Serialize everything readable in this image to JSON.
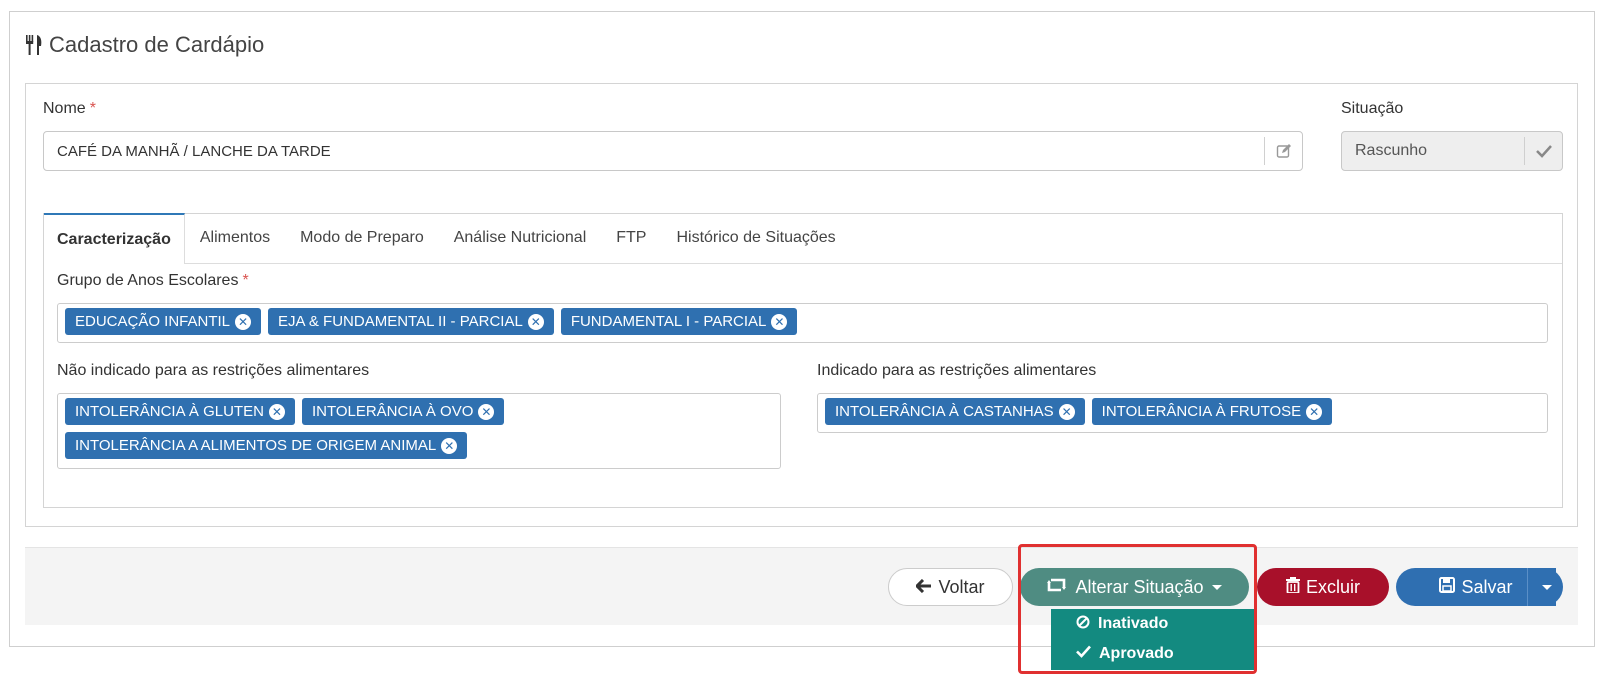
{
  "page": {
    "title": "Cadastro de Cardápio",
    "title_icon": "utensils-icon"
  },
  "form": {
    "nome_label": "Nome",
    "required_mark": "*",
    "nome_value": "CAFÉ DA MANHÃ / LANCHE DA TARDE",
    "situacao_label": "Situação",
    "situacao_value": "Rascunho"
  },
  "tabs": [
    {
      "label": "Caracterização",
      "active": true
    },
    {
      "label": "Alimentos"
    },
    {
      "label": "Modo de Preparo"
    },
    {
      "label": "Análise Nutricional"
    },
    {
      "label": "FTP"
    },
    {
      "label": "Histórico de Situações"
    }
  ],
  "caracterizacao": {
    "grupo_label": "Grupo de Anos Escolares",
    "grupo_tags": [
      "EDUCAÇÃO INFANTIL",
      "EJA & FUNDAMENTAL II - PARCIAL",
      "FUNDAMENTAL I - PARCIAL"
    ],
    "nao_indicado_label": "Não indicado para as restrições alimentares",
    "nao_indicado_tags": [
      "INTOLERÂNCIA À GLUTEN",
      "INTOLERÂNCIA À OVO",
      "INTOLERÂNCIA A ALIMENTOS DE ORIGEM ANIMAL"
    ],
    "indicado_label": "Indicado para as restrições alimentares",
    "indicado_tags": [
      "INTOLERÂNCIA À CASTANHAS",
      "INTOLERÂNCIA À FRUTOSE"
    ]
  },
  "footer": {
    "voltar": "Voltar",
    "alterar_situacao": "Alterar Situação",
    "excluir": "Excluir",
    "salvar": "Salvar"
  },
  "dropdown": {
    "items": [
      "Inativado",
      "Aprovado"
    ]
  },
  "colors": {
    "primary": "#2f70b0",
    "alterar": "#4f8c82",
    "excluir": "#a8102a",
    "dropdown_bg": "#138a80",
    "highlight": "#e03030"
  }
}
